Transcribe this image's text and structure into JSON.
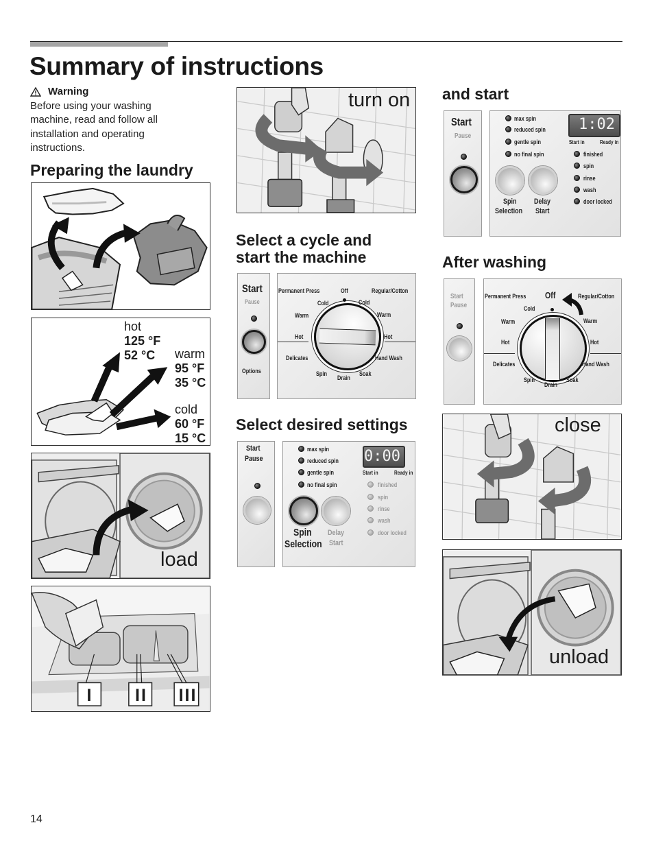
{
  "page": {
    "title": "Summary of instructions",
    "page_number": "14"
  },
  "warning": {
    "icon": "warning-triangle-icon",
    "label": "Warning",
    "text": "Before using your washing machine, read and follow all installation and operating instructions."
  },
  "sections": {
    "preparing": "Preparing the laundry",
    "select_cycle": "Select a cycle and start the machine",
    "select_cycle_line1": "Select a cycle and",
    "select_cycle_line2": "start the machine",
    "desired_settings": "Select desired settings",
    "and_start": "and start",
    "after_washing": "After washing"
  },
  "illustrations": {
    "turn_on": "turn on",
    "load": "load",
    "close": "close",
    "unload": "unload",
    "dispenser_labels": [
      "I",
      "II",
      "III"
    ]
  },
  "temperatures": [
    {
      "name": "hot",
      "f": "125 °F",
      "c": "52 °C"
    },
    {
      "name": "warm",
      "f": "95 °F",
      "c": "35 °C"
    },
    {
      "name": "cold",
      "f": "60 °F",
      "c": "15 °C"
    }
  ],
  "dial": {
    "top_left": "Permanent Press",
    "top": "Off",
    "top_right": "Regular/Cotton",
    "left": [
      "Cold",
      "Warm",
      "Hot"
    ],
    "right": [
      "Cold",
      "Warm",
      "Hot"
    ],
    "bottom_left": "Delicates",
    "bottom_right": "Hand Wash",
    "bottom": [
      "Spin",
      "Drain",
      "Soak"
    ]
  },
  "panel_cycle": {
    "start": "Start",
    "pause": "Pause",
    "options": "Options"
  },
  "panel_settings": {
    "start": "Start",
    "pause": "Pause",
    "spin_options": [
      "max spin",
      "reduced spin",
      "gentle spin",
      "no final spin"
    ],
    "display": "0:00",
    "start_in": "Start in",
    "ready_in": "Ready in",
    "status": [
      "finished",
      "spin",
      "rinse",
      "wash",
      "door locked"
    ],
    "spin_selection_1": "Spin",
    "spin_selection_2": "Selection",
    "delay_start_1": "Delay",
    "delay_start_2": "Start"
  },
  "panel_start": {
    "start": "Start",
    "pause": "Pause",
    "spin_options": [
      "max spin",
      "reduced spin",
      "gentle spin",
      "no final spin"
    ],
    "display": "1:02",
    "start_in": "Start in",
    "ready_in": "Ready in",
    "status": [
      "finished",
      "spin",
      "rinse",
      "wash",
      "door locked"
    ],
    "spin_selection_1": "Spin",
    "spin_selection_2": "Selection",
    "delay_start_1": "Delay",
    "delay_start_2": "Start"
  },
  "panel_after": {
    "start": "Start",
    "pause": "Pause"
  }
}
